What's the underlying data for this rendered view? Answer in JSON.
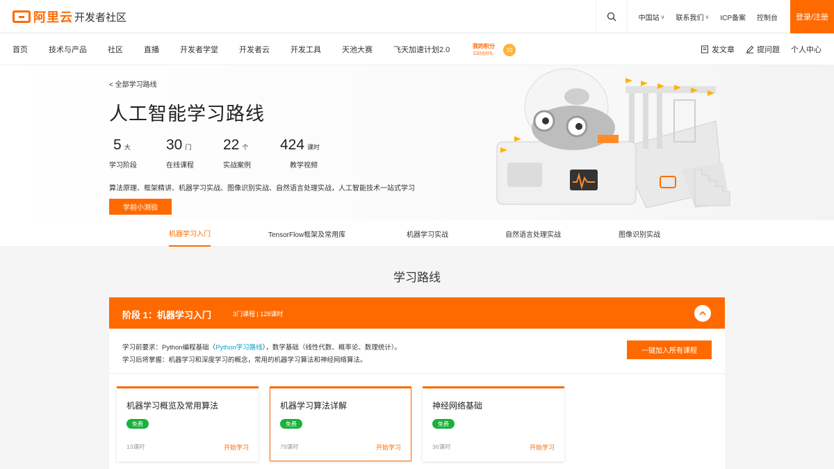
{
  "header": {
    "logo_text": "阿里云",
    "site_title": "开发者社区",
    "links": [
      "中国站",
      "联系我们",
      "ICP备案",
      "控制台"
    ],
    "login_label": "登录/注册",
    "accent": "#ff6a00"
  },
  "nav": {
    "items": [
      "首页",
      "技术与产品",
      "社区",
      "直播",
      "开发者学堂",
      "开发者云",
      "开发工具",
      "天池大赛",
      "飞天加速计划2.0"
    ],
    "points_title": "我的积分",
    "points_sub": "立刻兑好礼",
    "points_value": "10",
    "right": [
      "发文章",
      "提问题",
      "个人中心"
    ]
  },
  "hero": {
    "breadcrumb": "< 全部学习路线",
    "title": "人工智能学习路线",
    "stats": [
      {
        "num": "5",
        "unit": "大",
        "label": "学习阶段"
      },
      {
        "num": "30",
        "unit": "门",
        "label": "在线课程"
      },
      {
        "num": "22",
        "unit": "个",
        "label": "实战案例"
      },
      {
        "num": "424",
        "unit": "课时",
        "label": "教学视频"
      }
    ],
    "desc": "算法原理、框架精讲、机器学习实战、图像识别实战、自然语言处理实战，人工智能技术一站式学习",
    "quiz_label": "学前小测验"
  },
  "tabs": [
    "机器学习入门",
    "TensorFlow框架及常用库",
    "机器学习实战",
    "自然语言处理实战",
    "图像识别实战"
  ],
  "section_title": "学习路线",
  "stage": {
    "name": "阶段 1：机器学习入门",
    "meta": "3门课程 | 128课时",
    "req_prefix": "学习前要求：Python编程基础（",
    "req_link": "Python学习路线",
    "req_suffix": "），数学基础（线性代数、概率论、数理统计）。",
    "goal": "学习后将掌握：机器学习和深度学习的概念，常用的机器学习算法和神经网络算法。",
    "join_label": "一键加入所有课程",
    "courses": [
      {
        "title": "机器学习概览及常用算法",
        "badge": "免费",
        "hours": "13课时",
        "start": "开始学习"
      },
      {
        "title": "机器学习算法详解",
        "badge": "免费",
        "hours": "79课时",
        "start": "开始学习"
      },
      {
        "title": "神经网络基础",
        "badge": "免费",
        "hours": "36课时",
        "start": "开始学习"
      }
    ]
  }
}
